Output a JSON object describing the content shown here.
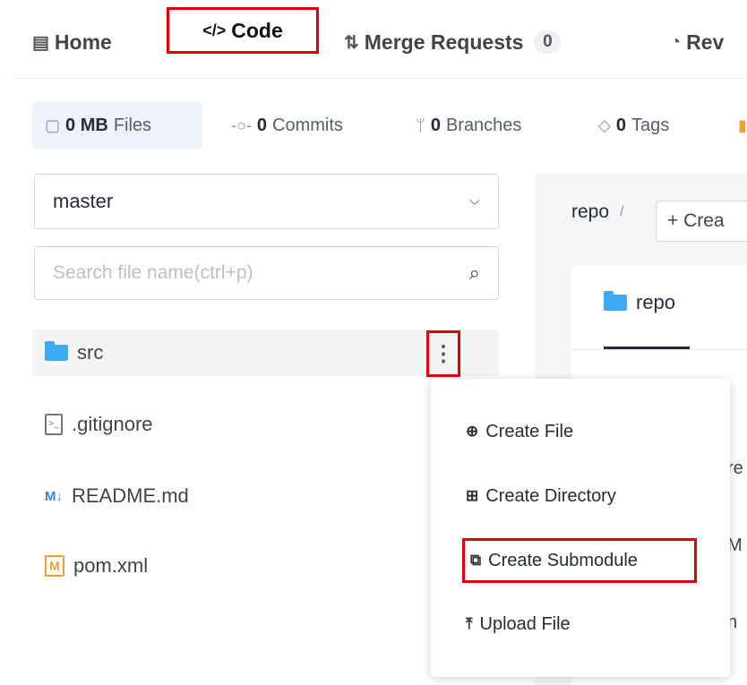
{
  "nav": {
    "tabs": [
      {
        "label": "Home",
        "icon": "home-doc-icon"
      },
      {
        "label": "Code",
        "icon": "code-icon"
      },
      {
        "label": "Merge Requests",
        "icon": "merge-icon",
        "badge": "0"
      },
      {
        "label": "Rev",
        "icon": "review-icon"
      }
    ]
  },
  "stats": {
    "files": {
      "value": "0 MB",
      "label": "Files"
    },
    "commits": {
      "value": "0",
      "label": "Commits"
    },
    "branches": {
      "value": "0",
      "label": "Branches"
    },
    "tags": {
      "value": "0",
      "label": "Tags"
    }
  },
  "branch": {
    "selected": "master"
  },
  "search": {
    "placeholder": "Search file name(ctrl+p)"
  },
  "tree": {
    "items": [
      {
        "name": "src",
        "type": "folder"
      },
      {
        "name": ".gitignore",
        "type": "file"
      },
      {
        "name": "README.md",
        "type": "markdown"
      },
      {
        "name": "pom.xml",
        "type": "maven"
      }
    ]
  },
  "right": {
    "breadcrumb_root": "repo",
    "breadcrumb_sep": "/",
    "create_label": "+ Crea",
    "repo_tab": "repo",
    "peek": [
      "re",
      "M",
      "n"
    ]
  },
  "menu": {
    "items": [
      {
        "label": "Create File"
      },
      {
        "label": "Create Directory"
      },
      {
        "label": "Create Submodule"
      },
      {
        "label": "Upload File"
      }
    ]
  },
  "colors": {
    "highlight": "#e00000",
    "folder": "#3eaaf5",
    "accent_bg": "#eef2fa"
  }
}
